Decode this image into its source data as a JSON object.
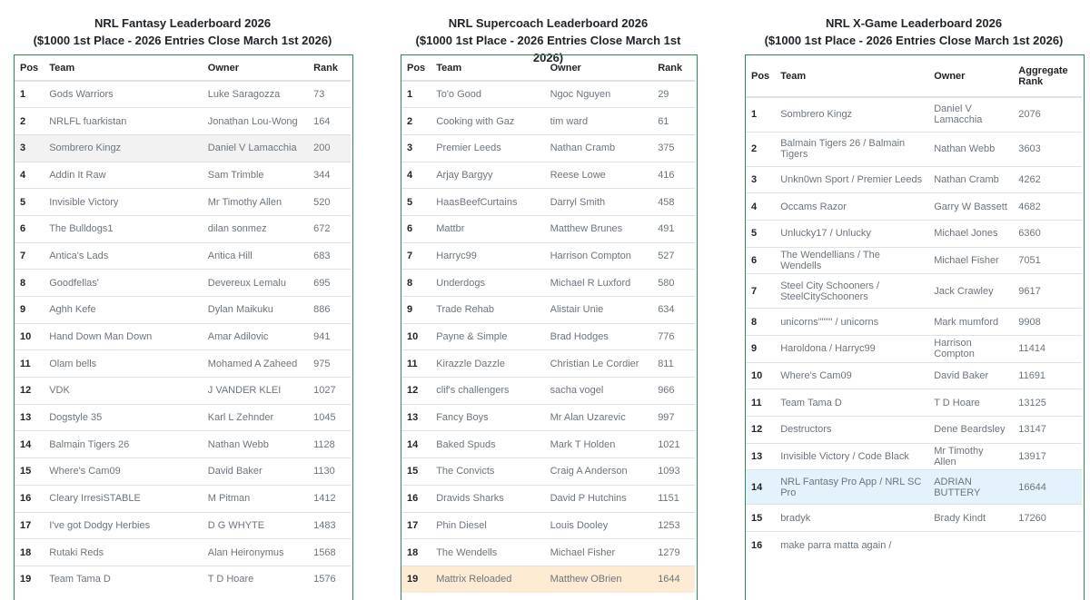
{
  "boards": [
    {
      "title": "NRL Fantasy Leaderboard 2026",
      "subtitle": "($1000 1st Place - 2026 Entries Close March 1st 2026)",
      "headers": {
        "pos": "Pos",
        "team": "Team",
        "owner": "Owner",
        "rank": "Rank"
      },
      "rows": [
        {
          "pos": "1",
          "team": "Gods Warriors",
          "owner": "Luke Saragozza",
          "rank": "73"
        },
        {
          "pos": "2",
          "team": "NRLFL fuarkistan",
          "owner": "Jonathan Lou-Wong",
          "rank": "164"
        },
        {
          "pos": "3",
          "team": "Sombrero Kingz",
          "owner": "Daniel V Lamacchia",
          "rank": "200",
          "hl": "grey"
        },
        {
          "pos": "4",
          "team": "Addin It Raw",
          "owner": "Sam Trimble",
          "rank": "344"
        },
        {
          "pos": "5",
          "team": "Invisible Victory",
          "owner": "Mr Timothy Allen",
          "rank": "520"
        },
        {
          "pos": "6",
          "team": "The Bulldogs1",
          "owner": "dilan sonmez",
          "rank": "672"
        },
        {
          "pos": "7",
          "team": "Antica's Lads",
          "owner": "Antica Hill",
          "rank": "683"
        },
        {
          "pos": "8",
          "team": "Goodfellas'",
          "owner": "Devereux Lemalu",
          "rank": "695"
        },
        {
          "pos": "9",
          "team": "Aghh Kefe",
          "owner": "Dylan Maikuku",
          "rank": "886"
        },
        {
          "pos": "10",
          "team": "Hand Down Man Down",
          "owner": "Amar Adilovic",
          "rank": "941"
        },
        {
          "pos": "11",
          "team": "Olam bells",
          "owner": "Mohamed A Zaheed",
          "rank": "975"
        },
        {
          "pos": "12",
          "team": "VDK",
          "owner": "J VANDER KLEI",
          "rank": "1027"
        },
        {
          "pos": "13",
          "team": "Dogstyle 35",
          "owner": "Karl L Zehnder",
          "rank": "1045"
        },
        {
          "pos": "14",
          "team": "Balmain Tigers 26",
          "owner": "Nathan Webb",
          "rank": "1128"
        },
        {
          "pos": "15",
          "team": "Where's Cam09",
          "owner": "David Baker",
          "rank": "1130"
        },
        {
          "pos": "16",
          "team": "Cleary IrresiSTABLE",
          "owner": "M Pitman",
          "rank": "1412"
        },
        {
          "pos": "17",
          "team": "I've got Dodgy Herbies",
          "owner": "D G WHYTE",
          "rank": "1483"
        },
        {
          "pos": "18",
          "team": "Rutaki Reds",
          "owner": "Alan Heironymus",
          "rank": "1568"
        },
        {
          "pos": "19",
          "team": "Team Tama D",
          "owner": "T D Hoare",
          "rank": "1576"
        }
      ]
    },
    {
      "title": "NRL Supercoach Leaderboard 2026",
      "subtitle": "($1000 1st Place - 2026 Entries Close March 1st 2026)",
      "headers": {
        "pos": "Pos",
        "team": "Team",
        "owner": "Owner",
        "rank": "Rank"
      },
      "rows": [
        {
          "pos": "1",
          "team": "To'o Good",
          "owner": "Ngoc Nguyen",
          "rank": "29"
        },
        {
          "pos": "2",
          "team": "Cooking with Gaz",
          "owner": "tim ward",
          "rank": "61"
        },
        {
          "pos": "3",
          "team": "Premier Leeds",
          "owner": "Nathan Cramb",
          "rank": "375"
        },
        {
          "pos": "4",
          "team": "Arjay Bargyy",
          "owner": "Reese Lowe",
          "rank": "416"
        },
        {
          "pos": "5",
          "team": "HaasBeefCurtains",
          "owner": "Darryl Smith",
          "rank": "458"
        },
        {
          "pos": "6",
          "team": "Mattbr",
          "owner": "Matthew Brunes",
          "rank": "491"
        },
        {
          "pos": "7",
          "team": "Harryc99",
          "owner": "Harrison Compton",
          "rank": "527"
        },
        {
          "pos": "8",
          "team": "Underdogs",
          "owner": "Michael R Luxford",
          "rank": "580"
        },
        {
          "pos": "9",
          "team": "Trade Rehab",
          "owner": "Alistair Unie",
          "rank": "634"
        },
        {
          "pos": "10",
          "team": "Payne & Simple",
          "owner": "Brad Hodges",
          "rank": "776"
        },
        {
          "pos": "11",
          "team": "Kirazzle Dazzle",
          "owner": "Christian Le Cordier",
          "rank": "811"
        },
        {
          "pos": "12",
          "team": "clif's challengers",
          "owner": "sacha vogel",
          "rank": "966"
        },
        {
          "pos": "13",
          "team": "Fancy Boys",
          "owner": "Mr Alan Uzarevic",
          "rank": "997"
        },
        {
          "pos": "14",
          "team": "Baked Spuds",
          "owner": "Mark T Holden",
          "rank": "1021"
        },
        {
          "pos": "15",
          "team": "The Convicts",
          "owner": "Craig A Anderson",
          "rank": "1093"
        },
        {
          "pos": "16",
          "team": "Dravids Sharks",
          "owner": "David P Hutchins",
          "rank": "1151"
        },
        {
          "pos": "17",
          "team": "Phin Diesel",
          "owner": "Louis Dooley",
          "rank": "1253"
        },
        {
          "pos": "18",
          "team": "The Wendells",
          "owner": "Michael Fisher",
          "rank": "1279"
        },
        {
          "pos": "19",
          "team": "Mattrix Reloaded",
          "owner": "Matthew OBrien",
          "rank": "1644",
          "hl": "peach"
        }
      ]
    },
    {
      "title": "NRL X-Game Leaderboard 2026",
      "subtitle": "($1000 1st Place - 2026 Entries Close March 1st 2026)",
      "headers": {
        "pos": "Pos",
        "team": "Team",
        "owner": "Owner",
        "rank": "Aggregate Rank"
      },
      "rows": [
        {
          "pos": "1",
          "team": "Sombrero Kingz",
          "owner": "Daniel V Lamacchia",
          "rank": "2076"
        },
        {
          "pos": "2",
          "team": "Balmain Tigers 26 / Balmain Tigers",
          "owner": "Nathan Webb",
          "rank": "3603"
        },
        {
          "pos": "3",
          "team": "Unkn0wn Sport / Premier Leeds",
          "owner": "Nathan Cramb",
          "rank": "4262"
        },
        {
          "pos": "4",
          "team": "Occams Razor",
          "owner": "Garry W Bassett",
          "rank": "4682"
        },
        {
          "pos": "5",
          "team": "Unlucky17 / Unlucky",
          "owner": "Michael Jones",
          "rank": "6360"
        },
        {
          "pos": "6",
          "team": "The Wendellians / The Wendells",
          "owner": "Michael Fisher",
          "rank": "7051"
        },
        {
          "pos": "7",
          "team": "Steel City Schooners / SteelCitySchooners",
          "owner": "Jack Crawley",
          "rank": "9617"
        },
        {
          "pos": "8",
          "team": "unicorns\"\"\"\" / unicorns",
          "owner": "Mark mumford",
          "rank": "9908"
        },
        {
          "pos": "9",
          "team": "Haroldona / Harryc99",
          "owner": "Harrison Compton",
          "rank": "11414"
        },
        {
          "pos": "10",
          "team": "Where's Cam09",
          "owner": "David Baker",
          "rank": "11691"
        },
        {
          "pos": "11",
          "team": "Team Tama D",
          "owner": "T D Hoare",
          "rank": "13125"
        },
        {
          "pos": "12",
          "team": "Destructors",
          "owner": "Dene Beardsley",
          "rank": "13147"
        },
        {
          "pos": "13",
          "team": "Invisible Victory / Code Black",
          "owner": "Mr Timothy Allen",
          "rank": "13917"
        },
        {
          "pos": "14",
          "team": "NRL Fantasy Pro App / NRL SC Pro",
          "owner": "ADRIAN BUTTERY",
          "rank": "16644",
          "hl": "blue"
        },
        {
          "pos": "15",
          "team": "bradyk",
          "owner": "Brady Kindt",
          "rank": "17260"
        },
        {
          "pos": "16",
          "team": "make parra matta again /",
          "owner": "",
          "rank": ""
        }
      ]
    }
  ]
}
